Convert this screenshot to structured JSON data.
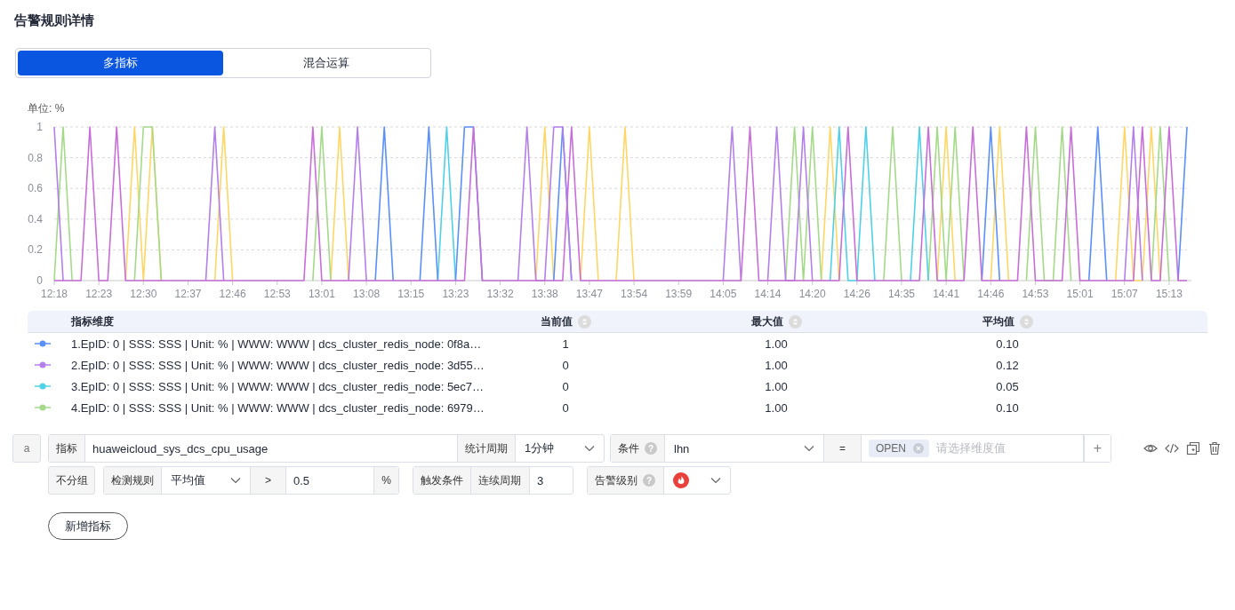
{
  "title": "告警规则详情",
  "segments": [
    {
      "label": "多指标",
      "selected": true
    },
    {
      "label": "混合运算",
      "selected": false
    }
  ],
  "chart": {
    "chart_data": {
      "type": "line",
      "ylabel": "单位: %",
      "grid": true,
      "ylim": [
        0,
        1
      ],
      "yticks": [
        0,
        0.2,
        0.4,
        0.6,
        0.8,
        1
      ],
      "categories": [
        "12:18",
        null,
        null,
        null,
        null,
        "12:23",
        null,
        null,
        null,
        null,
        "12:30",
        null,
        null,
        null,
        null,
        "12:37",
        null,
        null,
        null,
        null,
        "12:46",
        null,
        null,
        null,
        null,
        "12:53",
        null,
        null,
        null,
        null,
        "13:01",
        null,
        null,
        null,
        null,
        "13:08",
        null,
        null,
        null,
        null,
        "13:15",
        null,
        null,
        null,
        null,
        "13:23",
        null,
        null,
        null,
        null,
        "13:32",
        null,
        null,
        null,
        null,
        "13:38",
        null,
        null,
        null,
        null,
        "13:47",
        null,
        null,
        null,
        null,
        "13:54",
        null,
        null,
        null,
        null,
        "13:59",
        null,
        null,
        null,
        null,
        "14:05",
        null,
        null,
        null,
        null,
        "14:14",
        null,
        null,
        null,
        null,
        "14:20",
        null,
        null,
        null,
        null,
        "14:26",
        null,
        null,
        null,
        null,
        "14:35",
        null,
        null,
        null,
        null,
        "14:41",
        null,
        null,
        null,
        null,
        "14:46",
        null,
        null,
        null,
        null,
        "14:53",
        null,
        null,
        null,
        null,
        "15:01",
        null,
        null,
        null,
        null,
        "15:07",
        null,
        null,
        null,
        null,
        "15:13",
        null,
        null
      ],
      "series": [
        {
          "color": "#ffd666",
          "values": [
            null,
            null,
            null,
            null,
            null,
            null,
            null,
            null,
            0,
            1,
            0,
            1,
            0,
            null,
            null,
            null,
            null,
            null,
            0,
            1,
            0,
            null,
            null,
            null,
            null,
            null,
            null,
            null,
            null,
            null,
            null,
            0,
            1,
            0,
            null,
            null,
            null,
            null,
            null,
            null,
            null,
            null,
            null,
            null,
            null,
            null,
            null,
            null,
            null,
            null,
            null,
            null,
            null,
            null,
            0,
            1,
            0,
            null,
            null,
            0,
            1,
            0,
            null,
            0,
            1,
            0,
            null,
            null,
            null,
            null,
            null,
            null,
            null,
            null,
            null,
            null,
            null,
            null,
            null,
            null,
            null,
            null,
            null,
            null,
            null,
            null,
            0,
            1,
            0,
            null,
            null,
            null,
            null,
            null,
            null,
            null,
            null,
            null,
            null,
            0,
            1,
            0,
            null,
            null,
            null,
            0,
            1,
            0,
            null,
            null,
            null,
            null,
            null,
            null,
            null,
            null,
            null,
            null,
            null,
            0,
            1,
            0,
            0,
            1,
            0,
            null,
            null,
            null
          ]
        },
        {
          "color": "#a5d98a",
          "values": [
            0,
            1,
            0,
            null,
            null,
            null,
            null,
            null,
            null,
            0,
            1,
            1,
            0,
            null,
            null,
            null,
            null,
            null,
            null,
            null,
            null,
            null,
            null,
            null,
            null,
            null,
            null,
            null,
            null,
            0,
            1,
            0,
            null,
            null,
            null,
            null,
            null,
            null,
            null,
            null,
            null,
            null,
            null,
            null,
            null,
            null,
            null,
            null,
            null,
            null,
            null,
            null,
            null,
            null,
            null,
            null,
            null,
            null,
            null,
            null,
            null,
            null,
            null,
            null,
            null,
            null,
            null,
            null,
            null,
            null,
            null,
            null,
            null,
            null,
            null,
            null,
            null,
            null,
            null,
            null,
            null,
            null,
            0,
            1,
            0,
            1,
            0,
            null,
            null,
            null,
            null,
            null,
            null,
            0,
            1,
            0,
            null,
            null,
            0,
            1,
            0,
            1,
            0,
            null,
            null,
            null,
            null,
            null,
            null,
            0,
            1,
            0,
            0,
            1,
            0,
            null,
            null,
            null,
            null,
            null,
            null,
            null,
            null,
            0,
            1,
            0,
            null,
            null
          ]
        },
        {
          "color": "#4fd0e8",
          "values": [
            null,
            null,
            null,
            null,
            null,
            null,
            null,
            null,
            null,
            null,
            null,
            null,
            null,
            null,
            null,
            null,
            null,
            null,
            null,
            null,
            null,
            null,
            null,
            null,
            null,
            null,
            null,
            null,
            null,
            null,
            null,
            null,
            null,
            null,
            null,
            null,
            null,
            null,
            null,
            null,
            null,
            null,
            null,
            0,
            1,
            0,
            null,
            null,
            null,
            null,
            null,
            null,
            null,
            null,
            null,
            null,
            null,
            null,
            null,
            null,
            null,
            null,
            null,
            null,
            null,
            null,
            null,
            null,
            null,
            null,
            null,
            null,
            null,
            null,
            null,
            null,
            null,
            null,
            null,
            null,
            null,
            null,
            null,
            null,
            null,
            null,
            null,
            0,
            1,
            0,
            0,
            1,
            0,
            null,
            null,
            null,
            0,
            1,
            0,
            null,
            null,
            null,
            null,
            null,
            null,
            null,
            null,
            null,
            null,
            null,
            null,
            null,
            null,
            null,
            null,
            null,
            null,
            null,
            null,
            null,
            null,
            null,
            null,
            null,
            null,
            null,
            null,
            null
          ]
        },
        {
          "color": "#5b8ff9",
          "values": [
            null,
            null,
            null,
            null,
            null,
            null,
            null,
            null,
            null,
            null,
            null,
            null,
            null,
            null,
            null,
            null,
            null,
            null,
            null,
            null,
            null,
            null,
            null,
            null,
            null,
            null,
            null,
            null,
            null,
            null,
            null,
            null,
            null,
            null,
            null,
            null,
            0,
            1,
            0,
            null,
            null,
            0,
            1,
            0,
            null,
            0,
            1,
            1,
            0,
            null,
            null,
            null,
            null,
            null,
            null,
            null,
            0,
            1,
            0,
            null,
            null,
            null,
            null,
            null,
            null,
            null,
            null,
            null,
            null,
            null,
            null,
            null,
            null,
            null,
            null,
            null,
            null,
            null,
            null,
            null,
            null,
            null,
            null,
            null,
            null,
            null,
            null,
            null,
            null,
            null,
            null,
            null,
            null,
            null,
            null,
            null,
            null,
            null,
            null,
            null,
            null,
            null,
            null,
            null,
            0,
            1,
            0,
            null,
            null,
            null,
            null,
            null,
            null,
            null,
            null,
            null,
            0,
            1,
            0,
            null,
            null,
            null,
            null,
            null,
            null,
            null,
            0,
            1
          ]
        },
        {
          "color": "#b37feb",
          "values": [
            1,
            0,
            null,
            null,
            null,
            null,
            null,
            null,
            null,
            null,
            null,
            null,
            null,
            null,
            null,
            null,
            null,
            0,
            1,
            0,
            null,
            null,
            null,
            null,
            null,
            null,
            null,
            null,
            null,
            null,
            null,
            null,
            null,
            0,
            1,
            0,
            null,
            null,
            null,
            null,
            null,
            null,
            null,
            null,
            null,
            null,
            null,
            null,
            null,
            null,
            null,
            null,
            0,
            1,
            0,
            0,
            1,
            1,
            0,
            null,
            null,
            null,
            null,
            null,
            null,
            null,
            null,
            null,
            null,
            null,
            null,
            null,
            null,
            null,
            null,
            0,
            1,
            0,
            null,
            null,
            0,
            1,
            0,
            0,
            1,
            0,
            null,
            null,
            null,
            null,
            null,
            null,
            null,
            null,
            null,
            null,
            null,
            null,
            null,
            null,
            null,
            null,
            null,
            null,
            null,
            null,
            null,
            null,
            null,
            null,
            null,
            null,
            null,
            null,
            null,
            null,
            null,
            null,
            null,
            null,
            0,
            1,
            0,
            null,
            null,
            null,
            null,
            null
          ]
        },
        {
          "color": "#c86ed8",
          "values": [
            0,
            0,
            0,
            0,
            1,
            0,
            0,
            1,
            0,
            0,
            0,
            0,
            0,
            0,
            0,
            0,
            0,
            0,
            0,
            0,
            0,
            0,
            0,
            0,
            0,
            0,
            0,
            0,
            0,
            1,
            0,
            0,
            0,
            0,
            0,
            0,
            0,
            0,
            0,
            0,
            0,
            0,
            0,
            0,
            0,
            0,
            0,
            1,
            0,
            0,
            0,
            0,
            0,
            0,
            0,
            0,
            0,
            0,
            1,
            0,
            0,
            0,
            0,
            0,
            0,
            0,
            0,
            0,
            0,
            0,
            0,
            0,
            0,
            0,
            0,
            0,
            0,
            0,
            1,
            0,
            0,
            0,
            0,
            0,
            0,
            0,
            0,
            0,
            0,
            1,
            0,
            0,
            0,
            0,
            0,
            0,
            0,
            0,
            1,
            0,
            0,
            0,
            0,
            1,
            0,
            0,
            0,
            0,
            0,
            1,
            0,
            0,
            0,
            0,
            1,
            0,
            0,
            0,
            0,
            0,
            0,
            0,
            1,
            0,
            0,
            1,
            0,
            0
          ]
        }
      ]
    }
  },
  "table": {
    "columns": [
      "指标维度",
      "当前值",
      "最大值",
      "平均值"
    ],
    "rows": [
      {
        "color": "#5b8ff9",
        "name": "1.EpID: 0 | SSS: SSS | Unit: % | WWW: WWW | dcs_cluster_redis_node: 0f8a…",
        "current": "1",
        "max": "1.00",
        "avg": "0.10"
      },
      {
        "color": "#b37feb",
        "name": "2.EpID: 0 | SSS: SSS | Unit: % | WWW: WWW | dcs_cluster_redis_node: 3d55…",
        "current": "0",
        "max": "1.00",
        "avg": "0.12"
      },
      {
        "color": "#4fd0e8",
        "name": "3.EpID: 0 | SSS: SSS | Unit: % | WWW: WWW | dcs_cluster_redis_node: 5ec7…",
        "current": "0",
        "max": "1.00",
        "avg": "0.05"
      },
      {
        "color": "#a5d98a",
        "name": "4.EpID: 0 | SSS: SSS | Unit: % | WWW: WWW | dcs_cluster_redis_node: 6979…",
        "current": "0",
        "max": "1.00",
        "avg": "0.10"
      }
    ]
  },
  "rule": {
    "tag": "a",
    "metric_label": "指标",
    "metric_value": "huaweicloud_sys_dcs_cpu_usage",
    "period_label": "统计周期",
    "period_value": "1分钟",
    "condition_label": "条件",
    "condition_help": "?",
    "condition_key": "lhn",
    "operator": "=",
    "dimension_tags": [
      "OPEN"
    ],
    "dimension_placeholder": "请选择维度值",
    "add": "+",
    "group_button": "不分组",
    "detect_label": "检测规则",
    "detect_value": "平均值",
    "compare": ">",
    "threshold": "0.5",
    "unit": "%",
    "trigger_label": "触发条件",
    "consecutive_label": "连续周期",
    "consecutive_value": "3",
    "level_label": "告警级别",
    "level_help": "?"
  },
  "add_metric_button": "新增指标"
}
